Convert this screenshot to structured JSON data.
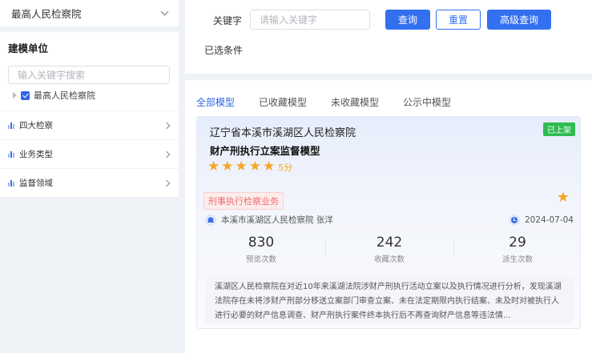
{
  "sidebar": {
    "org_select": "最高人民检察院",
    "unit_title": "建模单位",
    "unit_search_placeholder": "输入关键字搜索",
    "tree_root": "最高人民检察院",
    "filters": [
      {
        "label": "四大检察",
        "icon": "bar-chart-icon"
      },
      {
        "label": "业务类型",
        "icon": "bar-chart-icon"
      },
      {
        "label": "监督领域",
        "icon": "bar-chart-icon"
      }
    ]
  },
  "search": {
    "keyword_label": "关键字",
    "keyword_placeholder": "请输入关键字",
    "query_button": "查询",
    "reset_button": "重置",
    "advanced_button": "高级查询",
    "selected_label": "已选条件"
  },
  "tabs": [
    {
      "label": "全部模型",
      "active": true
    },
    {
      "label": "已收藏模型",
      "active": false
    },
    {
      "label": "未收藏模型",
      "active": false
    },
    {
      "label": "公示中模型",
      "active": false
    }
  ],
  "card": {
    "org": "辽宁省本溪市溪湖区人民检察院",
    "name": "财产刑执行立案监督模型",
    "status_badge": "已上架",
    "rating": 5,
    "score_text": "5分",
    "tag": "刑事执行检察业务",
    "author": "本溪市溪湖区人民检察院 张洋",
    "date": "2024-07-04",
    "stats": [
      {
        "value": "830",
        "label": "预览次数"
      },
      {
        "value": "242",
        "label": "收藏次数"
      },
      {
        "value": "29",
        "label": "派生次数"
      }
    ],
    "description": "溪湖区人民检察院在对近10年来溪湖法院涉财产刑执行活动立案以及执行情况进行分析，发现溪湖法院存在未将涉财产刑部分移送立案部门审查立案、未在法定期限内执行结案、未及时对被执行人进行必要的财产信息调查、财产刑执行案件终本执行后不再查询财产信息等违法情..."
  },
  "colors": {
    "primary": "#3370f0",
    "badge_green": "#2ebd4f",
    "star": "#f5a623",
    "tag_red": "#ec6f6f"
  }
}
